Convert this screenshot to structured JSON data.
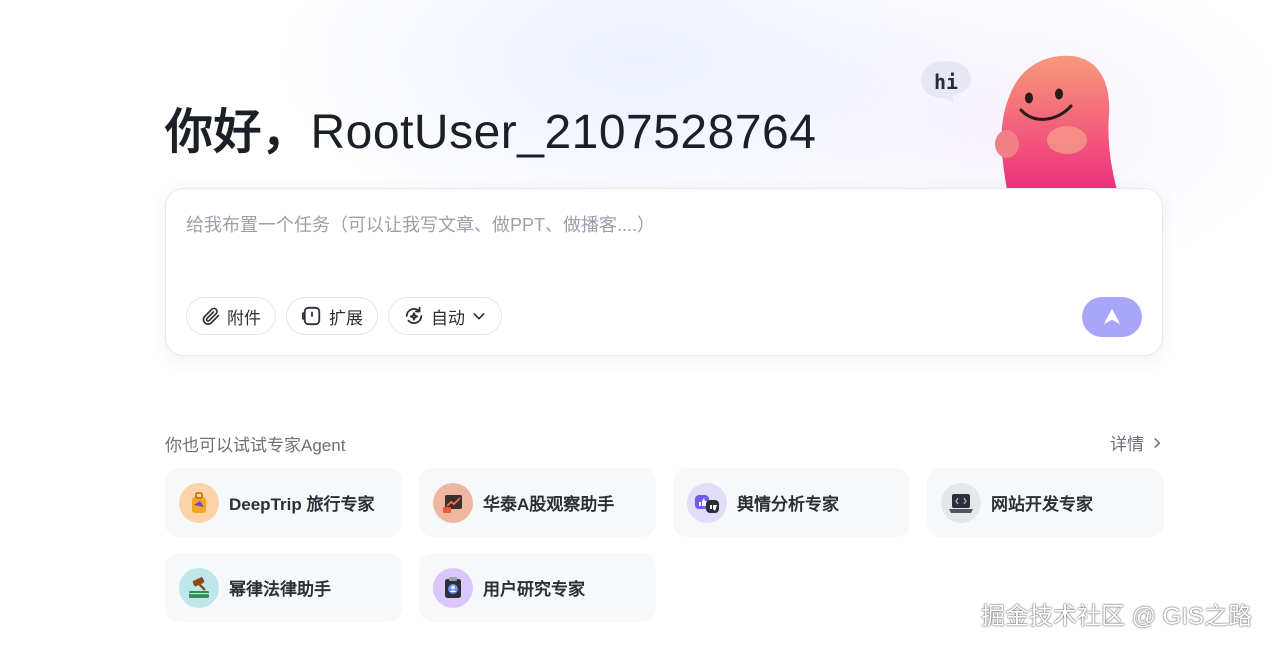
{
  "greeting": {
    "prefix": "你好，",
    "username": "RootUser_2107528764"
  },
  "mascot": {
    "bubble_text": "hi",
    "colors": {
      "top": "#f79a7a",
      "bottom": "#ee2f7d"
    }
  },
  "composer": {
    "placeholder": "给我布置一个任务（可以让我写文章、做PPT、做播客....）",
    "value": "",
    "tools": {
      "attach_label": "附件",
      "extend_label": "扩展",
      "mode_label": "自动"
    },
    "send_color": "#a9a5fb"
  },
  "agents": {
    "title": "你也可以试试专家Agent",
    "details_label": "详情",
    "items": [
      {
        "label": "DeepTrip 旅行专家",
        "icon": "luggage-icon",
        "color": "#fbd3a8"
      },
      {
        "label": "华泰A股观察助手",
        "icon": "stock-chart-icon",
        "color": "#f0b7a0"
      },
      {
        "label": "舆情分析专家",
        "icon": "thumbs-icon",
        "color": "#e3ddfb"
      },
      {
        "label": "网站开发专家",
        "icon": "laptop-code-icon",
        "color": "#e5e7eb"
      },
      {
        "label": "幂律法律助手",
        "icon": "gavel-icon",
        "color": "#bfe6ea"
      },
      {
        "label": "用户研究专家",
        "icon": "clipboard-user-icon",
        "color": "#d9c7fb"
      }
    ]
  },
  "watermark": "掘金技术社区 @ GIS之路"
}
